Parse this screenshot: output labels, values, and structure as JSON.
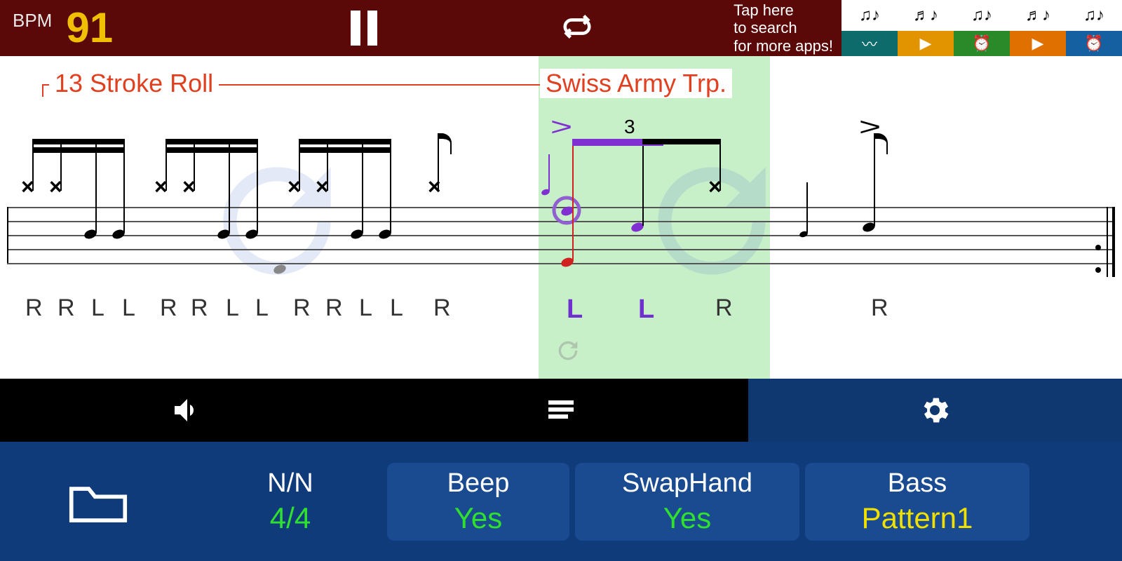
{
  "topbar": {
    "bpm_label": "BPM",
    "bpm_value": "91",
    "promo_line1": "Tap here",
    "promo_line2": "to search",
    "promo_line3": "for more apps!"
  },
  "rudiments": {
    "label1": "13 Stroke Roll",
    "label2": "Swiss Army Trp.",
    "triplet": "3"
  },
  "sticking": [
    "R",
    "R",
    "L",
    "L",
    "R",
    "R",
    "L",
    "L",
    "R",
    "R",
    "L",
    "L",
    "R",
    "L",
    "L",
    "R",
    "R"
  ],
  "sticking_active_idx": [
    13,
    14
  ],
  "settings": {
    "time_sig_label": "N/N",
    "time_sig_value": "4/4",
    "beep_label": "Beep",
    "beep_value": "Yes",
    "swap_label": "SwapHand",
    "swap_value": "Yes",
    "bass_label": "Bass",
    "bass_value": "Pattern1"
  }
}
